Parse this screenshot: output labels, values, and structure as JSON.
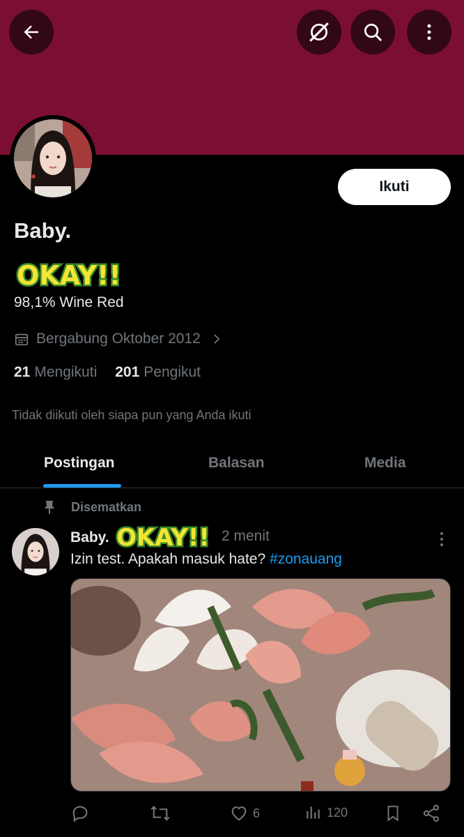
{
  "profile": {
    "display_name": "Baby.",
    "bio": "98,1% Wine Red",
    "joined": "Bergabung Oktober 2012",
    "following_count": "21",
    "following_label": "Mengikuti",
    "followers_count": "201",
    "followers_label": "Pengikut",
    "not_followed_text": "Tidak diikuti oleh siapa pun yang Anda ikuti",
    "follow_label": "Ikuti",
    "sticker_text": "OKAY!!"
  },
  "tabs": [
    {
      "label": "Postingan",
      "active": true
    },
    {
      "label": "Balasan",
      "active": false
    },
    {
      "label": "Media",
      "active": false
    }
  ],
  "post": {
    "pinned_label": "Disematkan",
    "author": "Baby.",
    "time": "2 menit",
    "text": "Izin test. Apakah masuk hate? ",
    "hashtag": "#zonauang",
    "like_count": "6",
    "view_count": "120"
  },
  "colors": {
    "banner": "#7b0f31",
    "accent": "#1d9bf0",
    "background": "#000000",
    "muted": "#71767b"
  },
  "icons": [
    "back-arrow-icon",
    "grok-icon",
    "search-icon",
    "more-vertical-icon",
    "calendar-icon",
    "chevron-right-icon",
    "pin-icon",
    "reply-icon",
    "repost-icon",
    "like-icon",
    "views-icon",
    "bookmark-icon",
    "share-icon"
  ]
}
